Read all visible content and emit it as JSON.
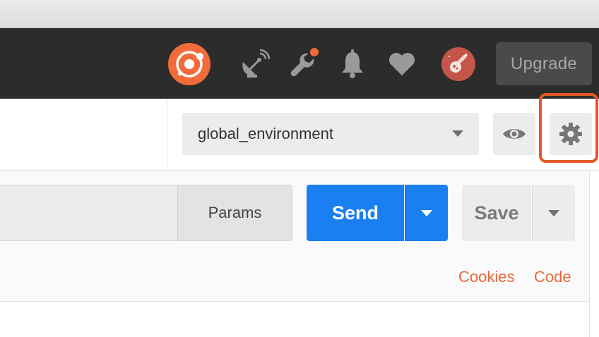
{
  "header": {
    "upgrade_label": "Upgrade",
    "icons": [
      "postman-logo-icon",
      "satellite-dish-icon",
      "wrench-icon",
      "bell-icon",
      "heart-icon",
      "avatar"
    ],
    "notification_dot_color": "#f26b3a"
  },
  "environment": {
    "selected": "global_environment"
  },
  "request": {
    "params_label": "Params",
    "send_label": "Send",
    "save_label": "Save",
    "cookies_label": "Cookies",
    "code_label": "Code"
  },
  "colors": {
    "accent_orange": "#f26b3a",
    "send_blue": "#1a7ff0",
    "header_bg": "#2c2c2c",
    "highlight": "#e2582a"
  }
}
